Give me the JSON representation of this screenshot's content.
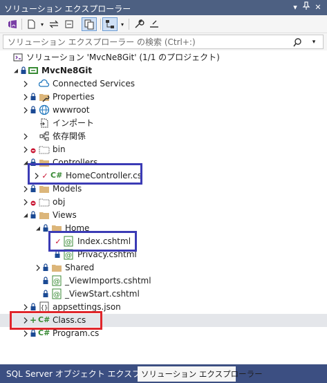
{
  "window": {
    "title": "ソリューション エクスプローラー",
    "bg": "#f5f5f5",
    "title_bg": "#4d6082"
  },
  "search": {
    "placeholder": "ソリューション エクスプローラー の検索 (Ctrl+:)"
  },
  "toolbar": {
    "items": [
      "vs-sync-icon",
      "home-icon",
      "dropdown-icon",
      "sync-arrows-icon",
      "collapse-all-icon",
      "show-all-files-icon",
      "pending-changes-filter-icon",
      "dropdown-icon",
      "properties-wrench-icon",
      "preview-icon"
    ]
  },
  "tree": {
    "solution": "ソリューション 'MvcNe8Git' (1/1 のプロジェクト)",
    "project": "MvcNe8Git",
    "items": [
      "Connected Services",
      "Properties",
      "wwwroot",
      "インポート",
      "依存関係",
      "bin",
      "Controllers",
      "HomeController.cs",
      "Models",
      "obj",
      "Views",
      "Home",
      "Index.cshtml",
      "Privacy.cshtml",
      "Shared",
      "_ViewImports.cshtml",
      "_ViewStart.cshtml",
      "appsettings.json",
      "Class.cs",
      "Program.cs"
    ],
    "marks": {
      "checkmark": "✓",
      "added": "+",
      "ignored": "⊖"
    }
  },
  "tabs": {
    "sql": "SQL Server オブジェクト エクスプローラー",
    "solution": "ソリューション エクスプローラー"
  },
  "colors": {
    "highlight_blue": "#3b3bb5",
    "highlight_red": "#e0262b",
    "csharp_green": "#388a34",
    "folder": "#dcb67a",
    "lock": "#1b4a94",
    "check_red": "#c8102e",
    "added_green": "#388a34",
    "ignored_red": "#c8102e",
    "selected_row": "#e4e6ea"
  }
}
